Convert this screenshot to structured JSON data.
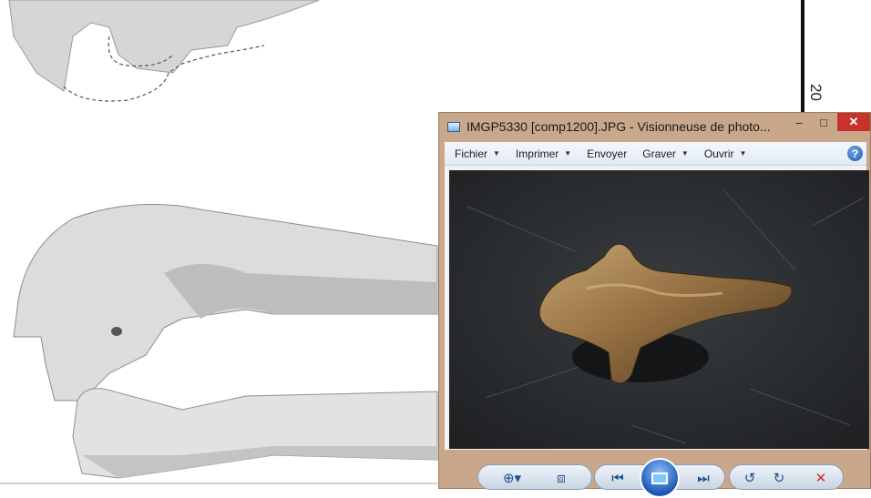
{
  "background_document": {
    "scale_label": "20"
  },
  "viewer": {
    "title": "IMGP5330 [comp1200].JPG - Visionneuse de photo...",
    "window_controls": {
      "minimize": "–",
      "maximize": "□",
      "close": "✕"
    },
    "menu": [
      {
        "label": "Fichier",
        "has_dropdown": true
      },
      {
        "label": "Imprimer",
        "has_dropdown": true
      },
      {
        "label": "Envoyer",
        "has_dropdown": false
      },
      {
        "label": "Graver",
        "has_dropdown": true
      },
      {
        "label": "Ouvrir",
        "has_dropdown": true
      }
    ],
    "help_icon": "?",
    "toolbar_icons": [
      "zoom-icon",
      "fit-to-window-icon",
      "previous-icon",
      "slideshow-icon",
      "next-icon",
      "rotate-left-icon",
      "rotate-right-icon",
      "delete-icon"
    ],
    "colors": {
      "frame": "#c9a78a",
      "close_button": "#c7332b",
      "accent_blue": "#1e4f8f"
    }
  }
}
